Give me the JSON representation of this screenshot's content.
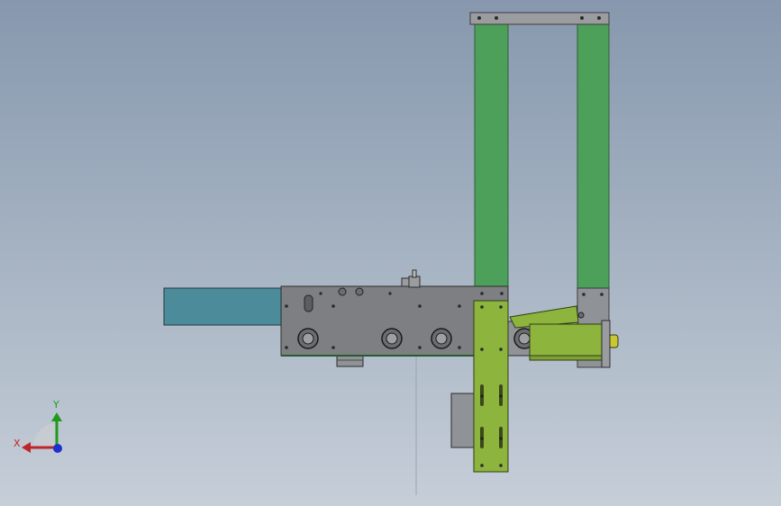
{
  "viewport": {
    "background_top": "#8798ae",
    "background_bottom": "#c6ced8"
  },
  "colors": {
    "frame_green": "#4ca05a",
    "bracket_olive": "#8db43c",
    "body_gray": "#7d7f82",
    "cylinder_teal": "#4b8b9a",
    "block_gray": "#8f9296",
    "accent_yellow": "#c8c832"
  },
  "triad": {
    "x_label": "X",
    "y_label": "Y",
    "x_color": "#c0242a",
    "y_color": "#1f9a1f",
    "z_color": "#1f2fd0",
    "icon": "coordinate-triad-icon"
  }
}
